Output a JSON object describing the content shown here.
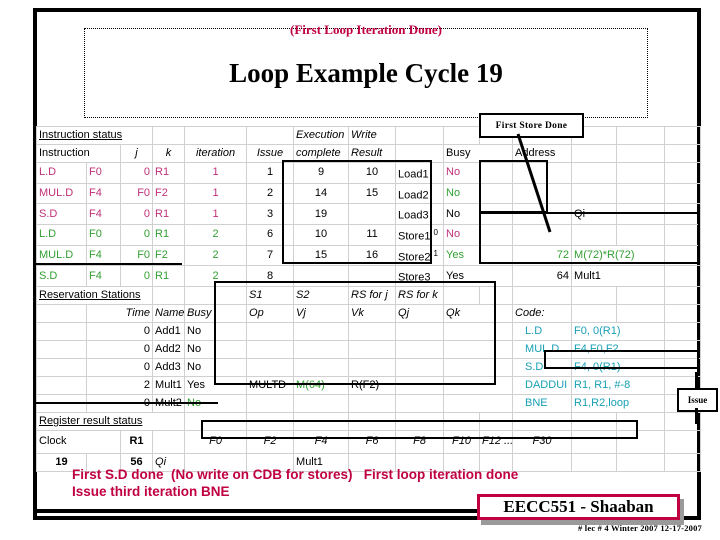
{
  "slide": {
    "subtitle": "(First Loop Iteration Done)",
    "title": "Loop Example Cycle 19"
  },
  "callouts": {
    "first_store_done": "First Store Done",
    "issue": "Issue"
  },
  "instruction_status": {
    "section_label": "Instruction status",
    "headers": {
      "instruction": "Instruction",
      "j": "j",
      "k": "k",
      "iteration": "iteration",
      "issue": "Issue",
      "execution": "Execution",
      "complete": "complete",
      "write": "Write",
      "result": "Result"
    },
    "rows": [
      {
        "op": "L.D",
        "dest": "F0",
        "j": "0",
        "k": "R1",
        "iteration": "1",
        "issue": "1",
        "exec_complete": "9",
        "write_result": "10",
        "color": "m"
      },
      {
        "op": "MUL.D",
        "dest": "F4",
        "j": "F0",
        "k": "F2",
        "iteration": "1",
        "issue": "2",
        "exec_complete": "14",
        "write_result": "15",
        "color": "m"
      },
      {
        "op": "S.D",
        "dest": "F4",
        "j": "0",
        "k": "R1",
        "iteration": "1",
        "issue": "3",
        "exec_complete": "19",
        "write_result": "",
        "color": "m"
      },
      {
        "op": "L.D",
        "dest": "F0",
        "j": "0",
        "k": "R1",
        "iteration": "2",
        "issue": "6",
        "exec_complete": "10",
        "write_result": "11",
        "color": "g"
      },
      {
        "op": "MUL.D",
        "dest": "F4",
        "j": "F0",
        "k": "F2",
        "iteration": "2",
        "issue": "7",
        "exec_complete": "15",
        "write_result": "16",
        "color": "g"
      },
      {
        "op": "S.D",
        "dest": "F4",
        "j": "0",
        "k": "R1",
        "iteration": "2",
        "issue": "8",
        "exec_complete": "",
        "write_result": "",
        "color": "g"
      }
    ]
  },
  "load_store_buffers": {
    "headers": {
      "busy": "Busy",
      "address": "Address",
      "qi": "Qi"
    },
    "rows": [
      {
        "name": "Load1",
        "tag": "",
        "busy": "No",
        "busy_color": "m",
        "address": "",
        "address_color": "",
        "qi": ""
      },
      {
        "name": "Load2",
        "tag": "",
        "busy": "No",
        "busy_color": "g",
        "address": "",
        "address_color": "",
        "qi": ""
      },
      {
        "name": "Load3",
        "tag": "",
        "busy": "No",
        "busy_color": "",
        "address": "",
        "address_color": "",
        "qi": "Qi"
      },
      {
        "name": "Store1",
        "tag": "0",
        "busy": "No",
        "busy_color": "m",
        "address": "",
        "address_color": "",
        "qi": ""
      },
      {
        "name": "Store2",
        "tag": "1",
        "busy": "Yes",
        "busy_color": "g",
        "address": "72",
        "address_color": "g",
        "qi": "M(72)*R(72)",
        "qi_color": "g"
      },
      {
        "name": "Store3",
        "tag": "",
        "busy": "Yes",
        "busy_color": "",
        "address": "64",
        "address_color": "",
        "qi": "Mult1"
      }
    ]
  },
  "reservation_stations": {
    "section_label": "Reservation Stations",
    "headers": {
      "time": "Time",
      "name": "Name",
      "busy": "Busy",
      "op": "Op",
      "s1": "S1",
      "s2": "S2",
      "vj": "Vj",
      "vk": "Vk",
      "rs_for_j": "RS for j",
      "rs_for_k": "RS for k",
      "qj": "Qj",
      "qk": "Qk"
    },
    "rows": [
      {
        "time": "0",
        "name": "Add1",
        "busy": "No",
        "busy_color": "",
        "op": "",
        "vj": "",
        "vj_color": "",
        "vk": "",
        "qj": "",
        "qk": ""
      },
      {
        "time": "0",
        "name": "Add2",
        "busy": "No",
        "busy_color": "",
        "op": "",
        "vj": "",
        "vj_color": "",
        "vk": "",
        "qj": "",
        "qk": ""
      },
      {
        "time": "0",
        "name": "Add3",
        "busy": "No",
        "busy_color": "",
        "op": "",
        "vj": "",
        "vj_color": "",
        "vk": "",
        "qj": "",
        "qk": ""
      },
      {
        "time": "2",
        "name": "Mult1",
        "busy": "Yes",
        "busy_color": "",
        "op": "MULTD",
        "vj": "M(64)",
        "vj_color": "g",
        "vk": "R(F2)",
        "qj": "",
        "qk": ""
      },
      {
        "time": "0",
        "name": "Mult2",
        "busy": "No",
        "busy_color": "g",
        "op": "",
        "vj": "",
        "vj_color": "",
        "vk": "",
        "qj": "",
        "qk": ""
      }
    ]
  },
  "code": {
    "label": "Code:",
    "lines": [
      {
        "op": "L.D",
        "args": "F0, 0(R1)"
      },
      {
        "op": "MUL.D",
        "args": "F4,F0,F2"
      },
      {
        "op": "S.D",
        "args": "F4, 0(R1)"
      },
      {
        "op": "DADDUI",
        "args": "R1, R1, #-8"
      },
      {
        "op": "BNE",
        "args": "R1,R2,loop"
      }
    ]
  },
  "register_result_status": {
    "section_label": "Register result status",
    "clock_label": "Clock",
    "clock_value": "19",
    "r1_label": "R1",
    "r1_value": "56",
    "qi_label": "Qi",
    "registers": [
      "F0",
      "F2",
      "F4",
      "F6",
      "F8",
      "F10",
      "F12 ...",
      "F30"
    ],
    "values": [
      "",
      "",
      "Mult1",
      "",
      "",
      "",
      "",
      ""
    ]
  },
  "notes": {
    "line1": "First S.D done  (No write on CDB for stores)   First loop iteration done",
    "line2": "Issue third iteration BNE"
  },
  "footer": {
    "badge": "EECC551 - Shaaban",
    "sub": "#  lec # 4   Winter 2007    12-17-2007"
  },
  "colors": {
    "accent_red": "#c00040",
    "iteration1": "#c0307a",
    "iteration2": "#33a033",
    "code_teal": "#18a0b4"
  }
}
